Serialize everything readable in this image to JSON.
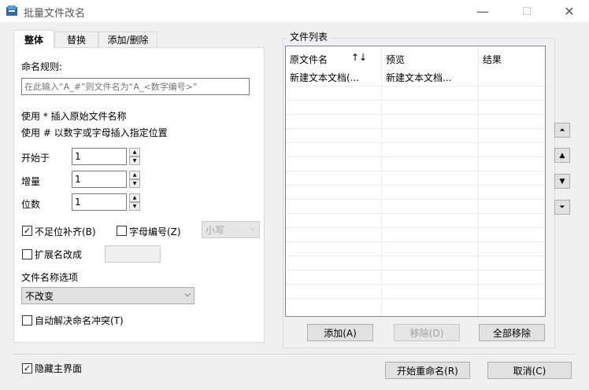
{
  "window": {
    "title": "批量文件改名"
  },
  "tabs": [
    "整体",
    "替换",
    "添加/删除"
  ],
  "naming": {
    "rule_label": "命名规则:",
    "rule_placeholder": "在此输入“A_#”则文件名为“A_<数字编号>”",
    "hint1": "使用 * 插入原始文件名称",
    "hint2": "使用 # 以数字或字母插入指定位置"
  },
  "fields": {
    "start_label": "开始于",
    "start_value": "1",
    "step_label": "增量",
    "step_value": "1",
    "digits_label": "位数",
    "digits_value": "1"
  },
  "options": {
    "pad_label": "不足位补齐(B)",
    "pad_checked": true,
    "alpha_label": "字母编号(Z)",
    "alpha_checked": false,
    "case_value": "小写",
    "ext_label": "扩展名改成",
    "ext_checked": false,
    "ext_value": ""
  },
  "filename_options": {
    "label": "文件名称选项",
    "value": "不改变"
  },
  "conflict": {
    "label": "自动解决命名冲突(T)",
    "checked": false
  },
  "file_list": {
    "title": "文件列表",
    "headers": {
      "original": "原文件名",
      "sort": "↑↓",
      "preview": "预览",
      "result": "结果"
    },
    "rows": [
      {
        "original": "新建文本文档(...",
        "preview": "新建文本文档...",
        "result": ""
      }
    ]
  },
  "list_buttons": {
    "add": "添加(A)",
    "remove": "移除(D)",
    "remove_all": "全部移除"
  },
  "footer": {
    "hide_label": "隐藏主界面",
    "hide_checked": true,
    "start": "开始重命名(R)",
    "cancel": "取消(C)"
  },
  "icons": {
    "minimize": "minimize-icon",
    "maximize": "maximize-icon",
    "close": "close-icon",
    "check": "✓"
  }
}
